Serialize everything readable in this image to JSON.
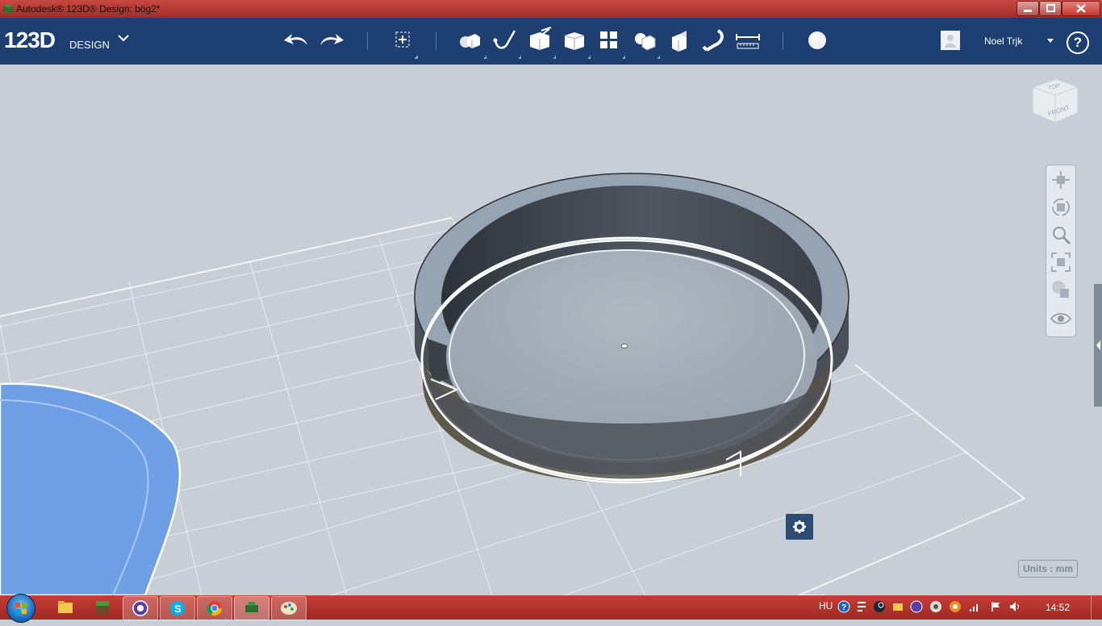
{
  "window": {
    "title": "Autodesk® 123D® Design: bög2*",
    "controls": {
      "minimize": "minimize-icon",
      "maximize": "maximize-icon",
      "close": "close-icon"
    }
  },
  "app": {
    "logo": "123D",
    "logo_sub": "DESIGN",
    "toolbar": [
      "undo-icon",
      "redo-icon",
      "transform-icon",
      "primitives-icon",
      "sketch-icon",
      "construct-icon",
      "modify-icon",
      "pattern-icon",
      "grouping-icon",
      "combine-icon",
      "snap-icon",
      "measure-icon",
      "material-icon"
    ],
    "user": {
      "name": "Noel Trjk"
    },
    "help": "?"
  },
  "viewcube": {
    "top": "TOP",
    "front": "FRONT"
  },
  "nav_tools": [
    "pan-icon",
    "orbit-icon",
    "zoom-icon",
    "fit-icon",
    "view-mode-icon",
    "visibility-icon"
  ],
  "units": "Units : mm",
  "colors": {
    "toolbar": "#1e3f72",
    "viewport": "#c7ced6",
    "selection_blue": "#6fa0e6",
    "title_red": "#b8322d"
  },
  "taskbar": {
    "apps": [
      "explorer-icon",
      "minecraft-icon",
      "app-icon",
      "skype-icon",
      "chrome-icon",
      "123d-design-icon",
      "paint-icon"
    ],
    "language": "HU",
    "tray": [
      "help-icon",
      "tray-icon",
      "steam-icon",
      "folder-icon",
      "app-icon",
      "network-icon",
      "avast-icon",
      "signal-icon",
      "flag-icon",
      "volume-icon"
    ],
    "clock": "14:52"
  }
}
